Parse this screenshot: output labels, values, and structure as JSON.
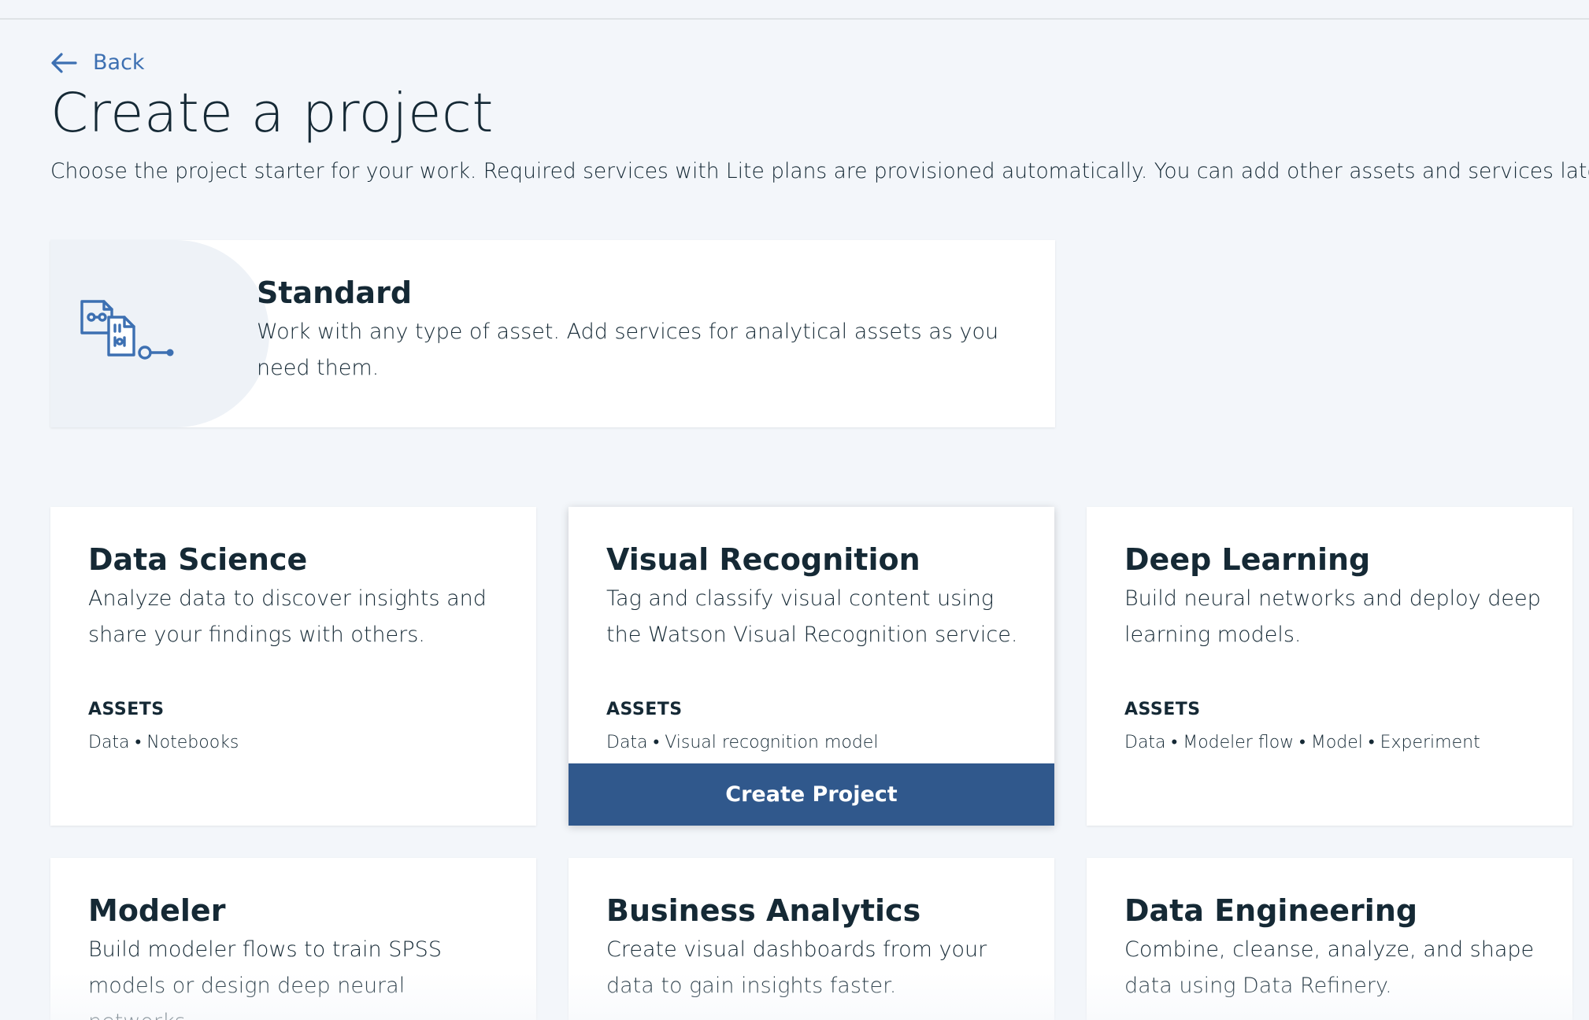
{
  "nav": {
    "back_label": "Back"
  },
  "header": {
    "title": "Create a project",
    "subtitle": "Choose the project starter for your work. Required services with Lite plans are provisioned automatically. You can add other assets and services later."
  },
  "standard": {
    "title": "Standard",
    "description": "Work with any type of asset. Add services for analytical assets as you need them.",
    "icon": "assets-flow-icon"
  },
  "assets_label": "ASSETS",
  "cards": [
    {
      "title": "Data Science",
      "description": "Analyze data to discover insights and share your findings with others.",
      "assets": "Data • Notebooks"
    },
    {
      "title": "Visual Recognition",
      "description": "Tag and classify visual content using the Watson Visual Recognition service.",
      "assets": "Data • Visual recognition model",
      "button": "Create Project"
    },
    {
      "title": "Deep Learning",
      "description": "Build neural networks and deploy deep learning models.",
      "assets": "Data • Modeler flow • Model • Experiment"
    },
    {
      "title": "Modeler",
      "description": "Build modeler flows to train SPSS models or design deep neural networks."
    },
    {
      "title": "Business Analytics",
      "description": "Create visual dashboards from your data to gain insights faster."
    },
    {
      "title": "Data Engineering",
      "description": "Combine, cleanse, analyze, and shape data using Data Refinery."
    }
  ],
  "colors": {
    "accent": "#3d70b2",
    "button": "#30588c",
    "background": "#f3f6fa",
    "text": "#152935"
  }
}
